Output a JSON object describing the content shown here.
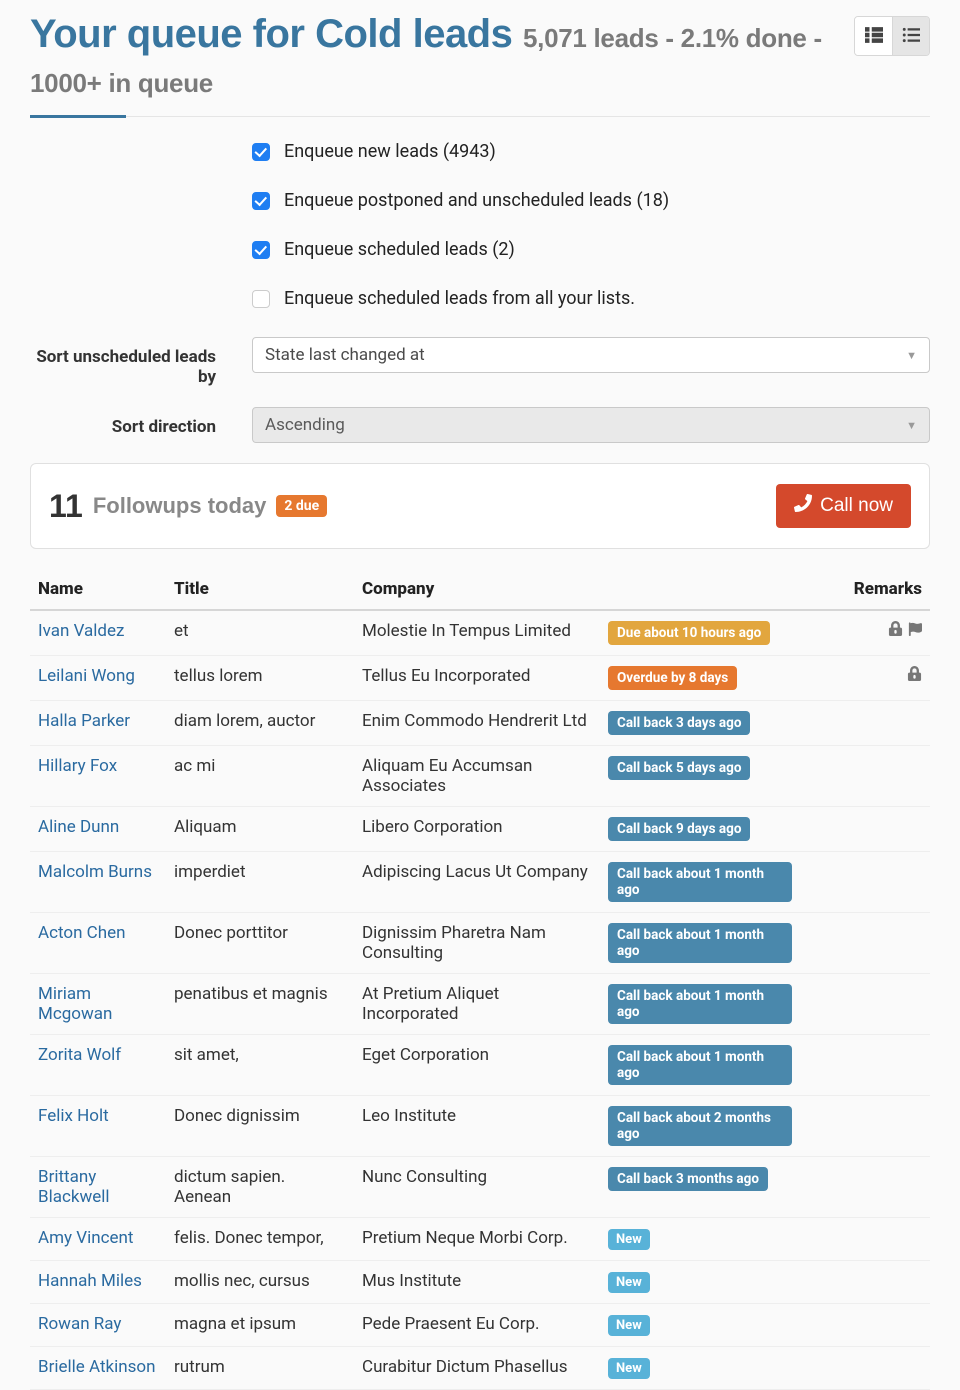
{
  "header": {
    "title_main": "Your queue for Cold leads",
    "subtitle": "5,071 leads - 2.1% done - 1000+ in queue"
  },
  "filters": {
    "checkboxes": [
      {
        "label": "Enqueue new leads (4943)",
        "checked": true
      },
      {
        "label": "Enqueue postponed and unscheduled leads (18)",
        "checked": true
      },
      {
        "label": "Enqueue scheduled leads (2)",
        "checked": true
      },
      {
        "label": "Enqueue scheduled leads from all your lists.",
        "checked": false
      }
    ],
    "sort_by": {
      "label": "Sort unscheduled leads by",
      "value": "State last changed at"
    },
    "sort_dir": {
      "label": "Sort direction",
      "value": "Ascending"
    }
  },
  "followups": {
    "count": "11",
    "label": "Followups today",
    "due_badge": "2 due",
    "call_now": "Call now"
  },
  "table": {
    "headers": {
      "name": "Name",
      "title": "Title",
      "company": "Company",
      "remarks": "Remarks"
    },
    "rows": [
      {
        "name": "Ivan Valdez",
        "title": "et",
        "company": "Molestie In Tempus Limited",
        "status": "Due about 10 hours ago",
        "status_class": "status-due",
        "icons": [
          "lock",
          "flag"
        ]
      },
      {
        "name": "Leilani Wong",
        "title": "tellus lorem",
        "company": "Tellus Eu Incorporated",
        "status": "Overdue by 8 days",
        "status_class": "status-overdue",
        "icons": [
          "lock"
        ]
      },
      {
        "name": "Halla Parker",
        "title": "diam lorem, auctor",
        "company": "Enim Commodo Hendrerit Ltd",
        "status": "Call back 3 days ago",
        "status_class": "status-callback",
        "icons": []
      },
      {
        "name": "Hillary Fox",
        "title": "ac mi",
        "company": "Aliquam Eu Accumsan Associates",
        "status": "Call back 5 days ago",
        "status_class": "status-callback",
        "icons": []
      },
      {
        "name": "Aline Dunn",
        "title": "Aliquam",
        "company": "Libero Corporation",
        "status": "Call back 9 days ago",
        "status_class": "status-callback",
        "icons": []
      },
      {
        "name": "Malcolm Burns",
        "title": "imperdiet",
        "company": "Adipiscing Lacus Ut Company",
        "status": "Call back about 1 month ago",
        "status_class": "status-callback",
        "icons": []
      },
      {
        "name": "Acton Chen",
        "title": "Donec porttitor",
        "company": "Dignissim Pharetra Nam Consulting",
        "status": "Call back about 1 month ago",
        "status_class": "status-callback",
        "icons": []
      },
      {
        "name": "Miriam Mcgowan",
        "title": "penatibus et magnis",
        "company": "At Pretium Aliquet Incorporated",
        "status": "Call back about 1 month ago",
        "status_class": "status-callback",
        "icons": []
      },
      {
        "name": "Zorita Wolf",
        "title": "sit amet,",
        "company": "Eget Corporation",
        "status": "Call back about 1 month ago",
        "status_class": "status-callback",
        "icons": []
      },
      {
        "name": "Felix Holt",
        "title": "Donec dignissim",
        "company": "Leo Institute",
        "status": "Call back about 2 months ago",
        "status_class": "status-callback",
        "icons": []
      },
      {
        "name": "Brittany Blackwell",
        "title": "dictum sapien. Aenean",
        "company": "Nunc Consulting",
        "status": "Call back 3 months ago",
        "status_class": "status-callback",
        "icons": []
      },
      {
        "name": "Amy Vincent",
        "title": "felis. Donec tempor,",
        "company": "Pretium Neque Morbi Corp.",
        "status": "New",
        "status_class": "status-new",
        "icons": []
      },
      {
        "name": "Hannah Miles",
        "title": "mollis nec, cursus",
        "company": "Mus Institute",
        "status": "New",
        "status_class": "status-new",
        "icons": []
      },
      {
        "name": "Rowan Ray",
        "title": "magna et ipsum",
        "company": "Pede Praesent Eu Corp.",
        "status": "New",
        "status_class": "status-new",
        "icons": []
      },
      {
        "name": "Brielle Atkinson",
        "title": "rutrum",
        "company": "Curabitur Dictum Phasellus",
        "status": "New",
        "status_class": "status-new",
        "icons": []
      }
    ]
  }
}
